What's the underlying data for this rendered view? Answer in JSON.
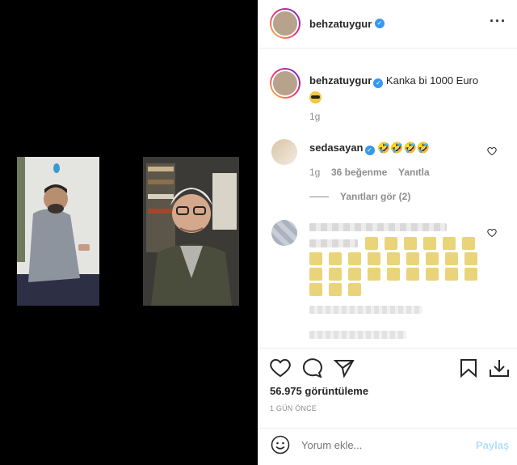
{
  "post": {
    "username": "behzatuygur",
    "caption": "Kanka bi 1000 Euro",
    "caption_time": "1g",
    "more_icon": "more-horizontal-icon"
  },
  "comments": [
    {
      "username": "sedasayan",
      "text": "🤣🤣🤣🤣",
      "time": "1g",
      "likes": "36 beğenme",
      "reply": "Yanıtla",
      "view_replies": "Yanıtları gör (2)"
    }
  ],
  "stats": {
    "views": "56.975 görüntüleme",
    "date": "1 GÜN ÖNCE"
  },
  "comment_box": {
    "placeholder": "Yorum ekle...",
    "post_label": "Paylaş"
  },
  "colors": {
    "verified": "#3897f0",
    "post_button": "#b2dffc",
    "media_bg": "#000000"
  }
}
